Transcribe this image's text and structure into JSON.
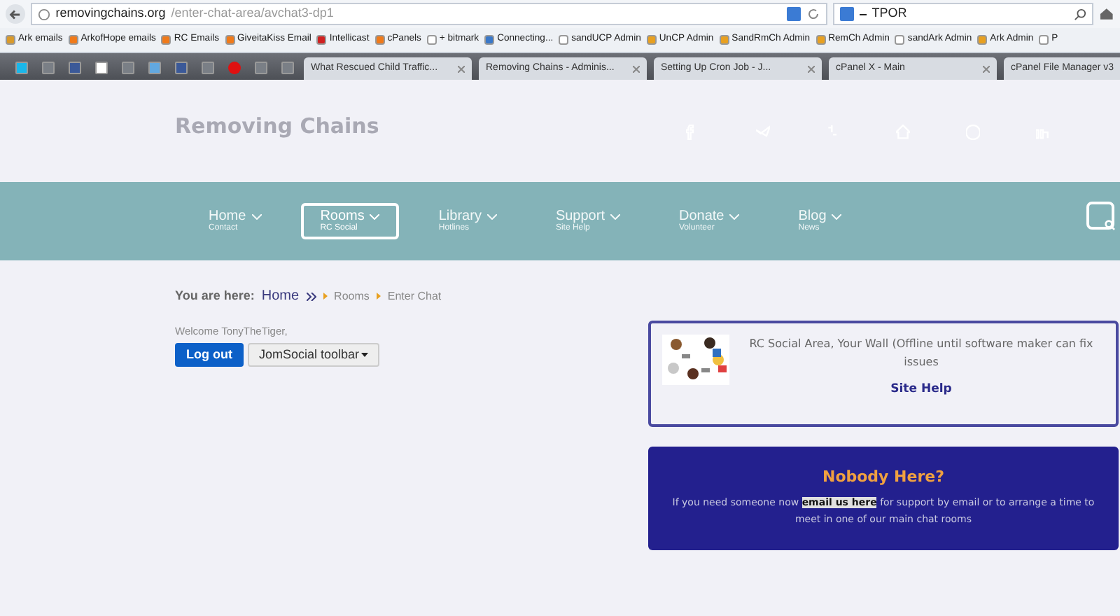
{
  "browser": {
    "url_host": "removingchains.org",
    "url_path": "/enter-chat-area/avchat3-dp1",
    "search_value": "TPOR",
    "bookmarks": [
      {
        "label": "Ark emails",
        "kind": "folder"
      },
      {
        "label": "ArkofHope emails",
        "kind": "cpanel"
      },
      {
        "label": "RC Emails",
        "kind": "cpanel"
      },
      {
        "label": "GiveitaKiss Email",
        "kind": "cpanel"
      },
      {
        "label": "Intellicast",
        "kind": "weather"
      },
      {
        "label": "cPanels",
        "kind": "cpanel"
      },
      {
        "label": "+ bitmark",
        "kind": "blank"
      },
      {
        "label": "Connecting...",
        "kind": "triangle"
      },
      {
        "label": "sandUCP Admin",
        "kind": "b"
      },
      {
        "label": "UnCP Admin",
        "kind": "joomla"
      },
      {
        "label": "SandRmCh Admin",
        "kind": "joomla"
      },
      {
        "label": "RemCh Admin",
        "kind": "joomla"
      },
      {
        "label": "sandArk Admin",
        "kind": "blank"
      },
      {
        "label": "Ark Admin",
        "kind": "joomla"
      },
      {
        "label": "P",
        "kind": "cloud"
      }
    ],
    "pinned": [
      {
        "kind": "vimeo"
      },
      {
        "kind": "blank"
      },
      {
        "kind": "facebook"
      },
      {
        "kind": "camera"
      },
      {
        "kind": "blank"
      },
      {
        "kind": "globe"
      },
      {
        "kind": "facebook"
      },
      {
        "kind": "blank"
      },
      {
        "kind": "record"
      },
      {
        "kind": "blank"
      },
      {
        "kind": "blank"
      }
    ],
    "tabs": [
      {
        "label": "What Rescued Child Traffic...",
        "selected": false
      },
      {
        "label": "Removing Chains - Adminis...",
        "selected": false
      },
      {
        "label": "Setting Up Cron Job - J...",
        "selected": false
      },
      {
        "label": "cPanel X - Main",
        "selected": false
      },
      {
        "label": "cPanel File Manager v3",
        "selected": false
      }
    ]
  },
  "site": {
    "logo": "Removing Chains",
    "nav": [
      {
        "label": "Home",
        "sub": "Contact",
        "selected": false
      },
      {
        "label": "Rooms",
        "sub": "RC Social",
        "selected": true
      },
      {
        "label": "Library",
        "sub": "Hotlines",
        "selected": false
      },
      {
        "label": "Support",
        "sub": "Site Help",
        "selected": false
      },
      {
        "label": "Donate",
        "sub": "Volunteer",
        "selected": false
      },
      {
        "label": "Blog",
        "sub": "News",
        "selected": false
      }
    ],
    "breadcrumb": {
      "prefix": "You are here:",
      "home": "Home",
      "items": [
        "Rooms",
        "Enter Chat"
      ]
    },
    "welcome": "Welcome TonyTheTiger,",
    "logout_button": "Log out",
    "toolbar_button": "JomSocial toolbar",
    "social_card": {
      "text": "RC Social Area, Your Wall (Offline until software maker can fix issues",
      "link": "Site Help"
    },
    "help_box": {
      "title": "Nobody Here?",
      "before": "If you need someone now",
      "link": "email us here",
      "after": "for support by email or to arrange a time to meet in one of our main chat rooms"
    }
  }
}
